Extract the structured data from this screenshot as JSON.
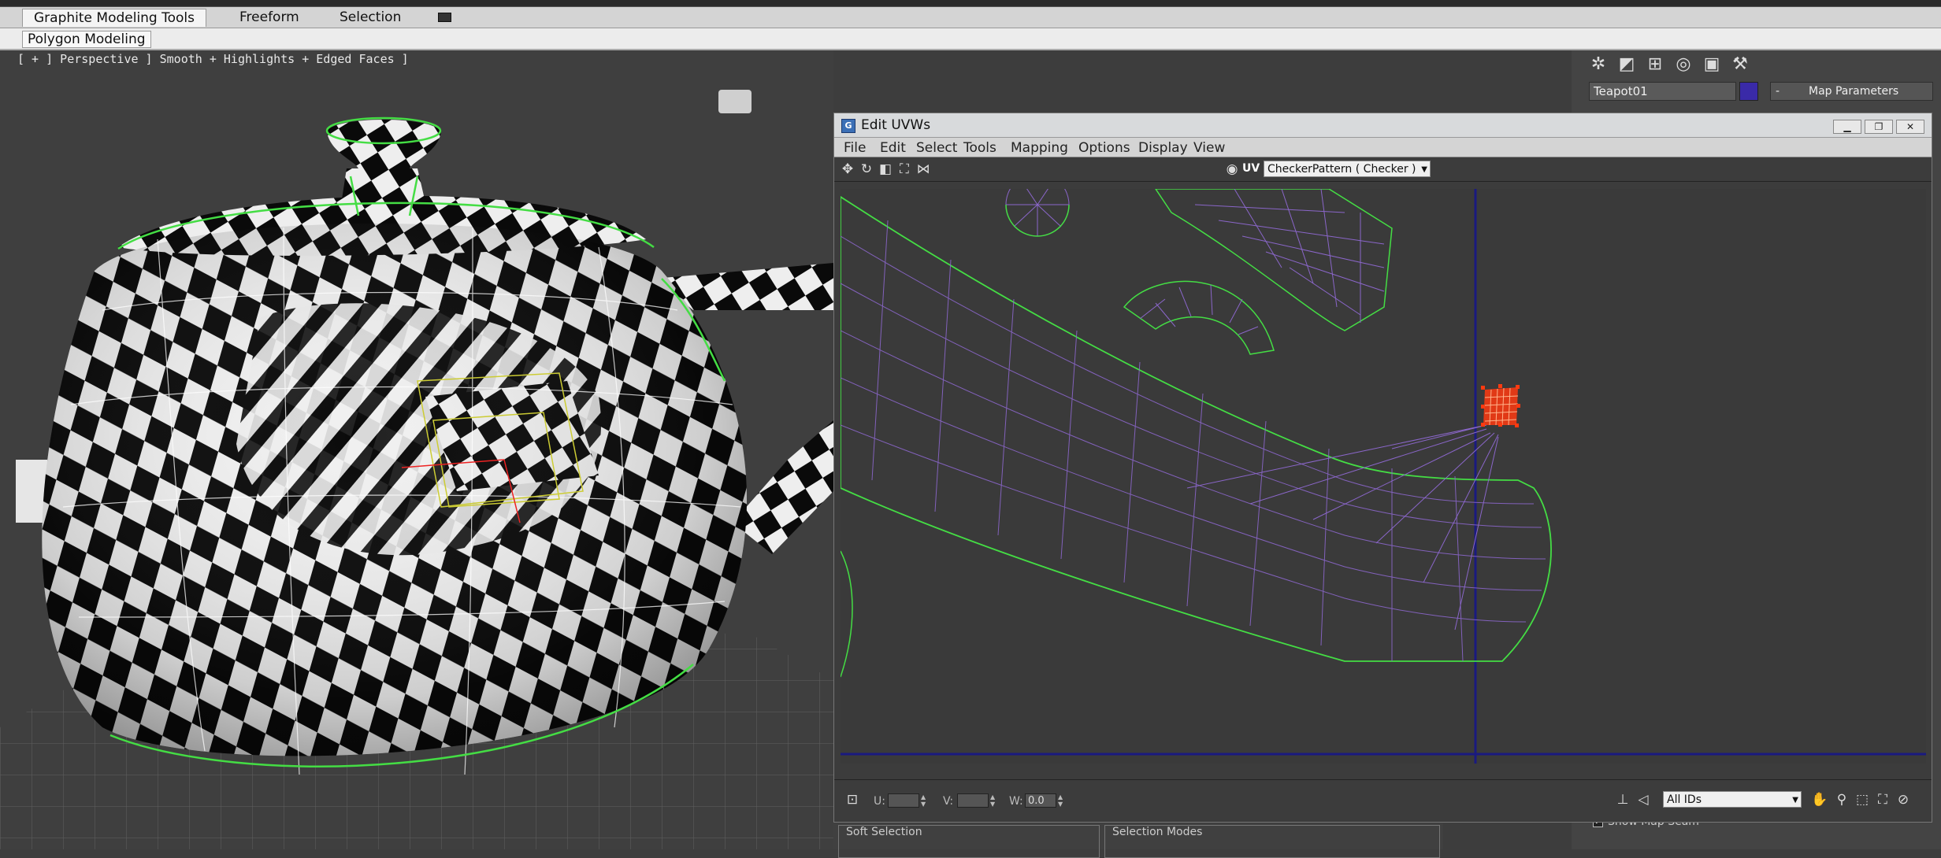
{
  "ribbon": {
    "tabs": [
      "Graphite Modeling Tools",
      "Freeform",
      "Selection"
    ],
    "active_tab": "Graphite Modeling Tools",
    "panel_button": "Polygon Modeling"
  },
  "viewport": {
    "label": "[ + ] Perspective ] Smooth + Highlights + Edged Faces ]"
  },
  "command_panel": {
    "object_name": "Teapot01",
    "object_color": "#3a2aa8",
    "rollout_title": "Map Parameters",
    "rollout_toggle": "-",
    "show_map_seam_label": "Show Map Seam",
    "show_map_seam_checked": true
  },
  "uvw_editor": {
    "title": "Edit UVWs",
    "menu": [
      "File",
      "Edit",
      "Select",
      "Tools",
      "Mapping",
      "Options",
      "Display",
      "View"
    ],
    "uv_label": "UV",
    "texture": "CheckerPattern  ( Checker )",
    "coords": {
      "u_label": "U:",
      "u_value": "",
      "v_label": "V:",
      "v_value": "",
      "w_label": "W:",
      "w_value": "0.0"
    },
    "id_filter": "All IDs"
  },
  "bottom_panels": {
    "soft_selection": "Soft Selection",
    "selection_modes": "Selection Modes"
  },
  "colors": {
    "seam_green": "#44dd44",
    "uv_edge_purple": "#8a66c9",
    "selection_red": "#ff3a10",
    "uv_boundary_blue": "#1a1a80"
  }
}
